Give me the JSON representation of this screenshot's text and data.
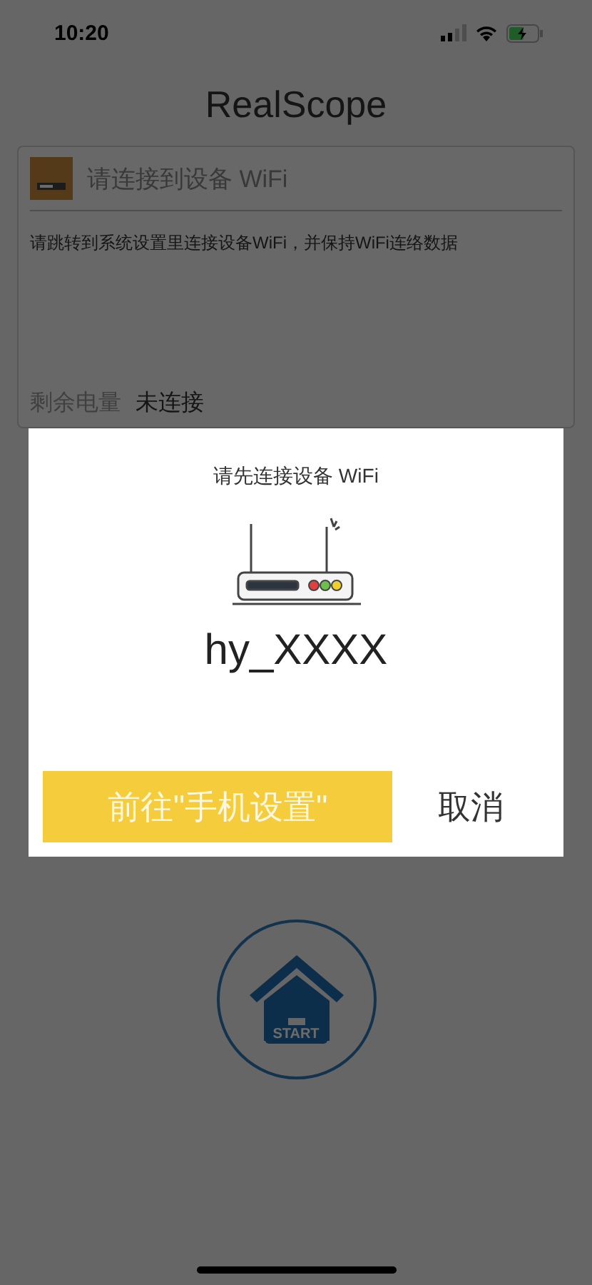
{
  "status_bar": {
    "time": "10:20"
  },
  "app_title": "RealScope",
  "device_card": {
    "title": "请连接到设备 WiFi",
    "description": "请跳转到系统设置里连接设备WiFi，并保持WiFi连络数据",
    "battery_label": "剩余电量",
    "battery_value": "未连接"
  },
  "start_button": {
    "label": "START"
  },
  "dialog": {
    "title": "请先连接设备 WiFi",
    "network_name": "hy_XXXX",
    "buttons": [
      {
        "label": "前往\"手机设置\"",
        "kind": "primary"
      },
      {
        "label": "取消",
        "kind": "secondary"
      }
    ]
  }
}
